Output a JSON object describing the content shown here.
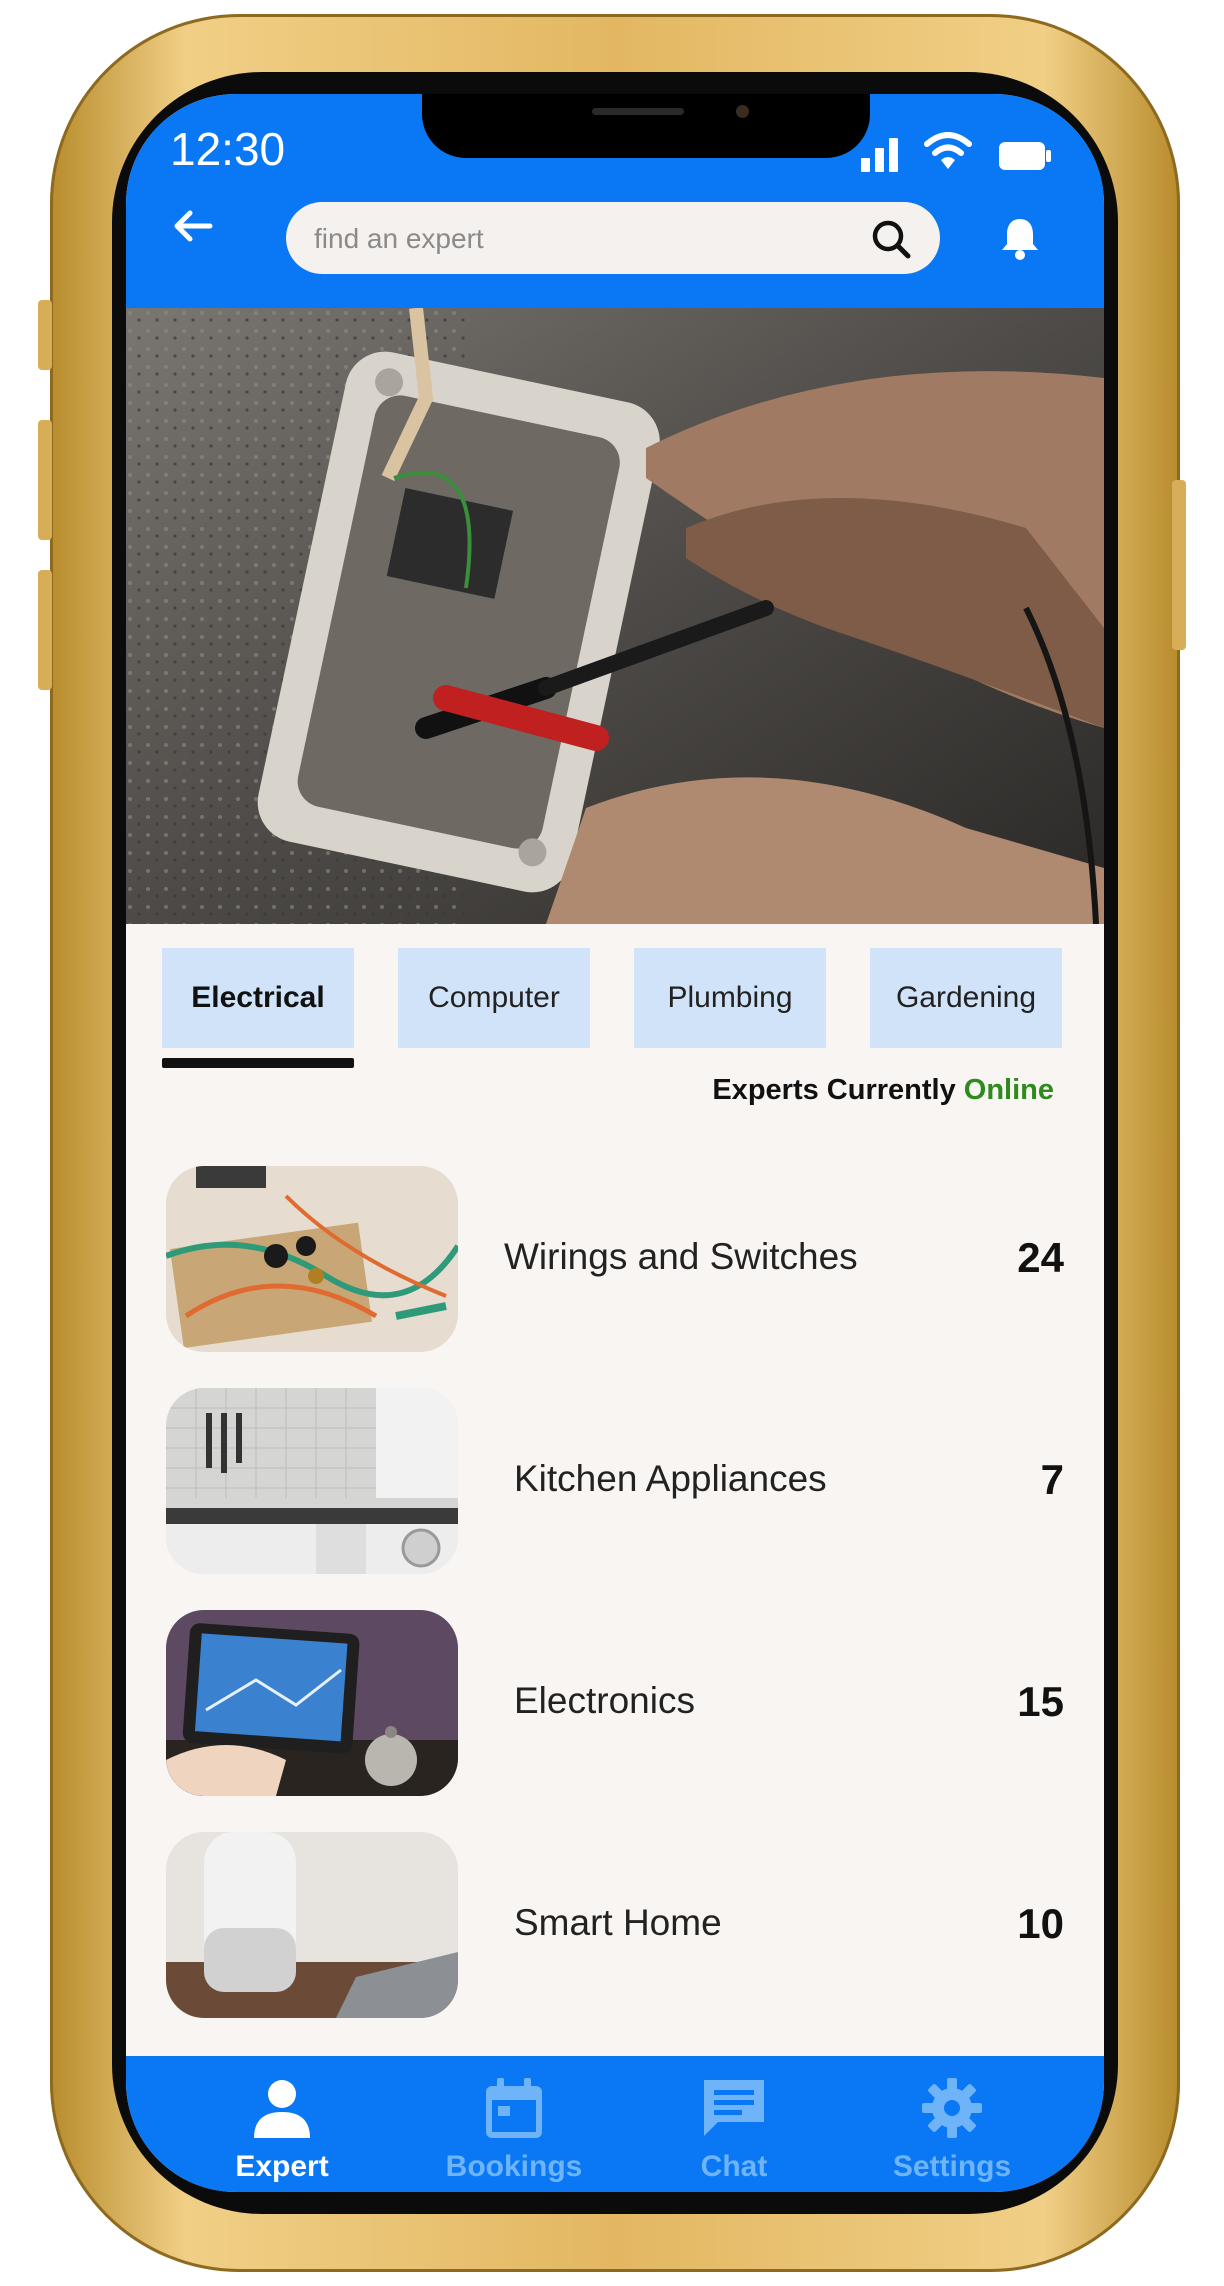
{
  "status_bar": {
    "time": "12:30"
  },
  "header": {
    "search_placeholder": "find an expert"
  },
  "category_tabs": [
    {
      "label": "Electrical",
      "active": true
    },
    {
      "label": "Computer",
      "active": false
    },
    {
      "label": "Plumbing",
      "active": false
    },
    {
      "label": "Gardening",
      "active": false
    }
  ],
  "online_header": {
    "prefix": "Experts Currently",
    "status": "Online"
  },
  "services": [
    {
      "name": "Wirings and Switches",
      "count": "24"
    },
    {
      "name": "Kitchen Appliances",
      "count": "7"
    },
    {
      "name": "Electronics",
      "count": "15"
    },
    {
      "name": "Smart Home",
      "count": "10"
    }
  ],
  "bottom_nav": [
    {
      "label": "Expert",
      "icon": "person-icon",
      "active": true
    },
    {
      "label": "Bookings",
      "icon": "calendar-icon",
      "active": false
    },
    {
      "label": "Chat",
      "icon": "chat-icon",
      "active": false
    },
    {
      "label": "Settings",
      "icon": "gear-icon",
      "active": false
    }
  ],
  "colors": {
    "primary": "#0a78f5",
    "tab_bg": "#d0e3f8",
    "online": "#2e8b1e",
    "frame_gold": "#e3b762"
  }
}
